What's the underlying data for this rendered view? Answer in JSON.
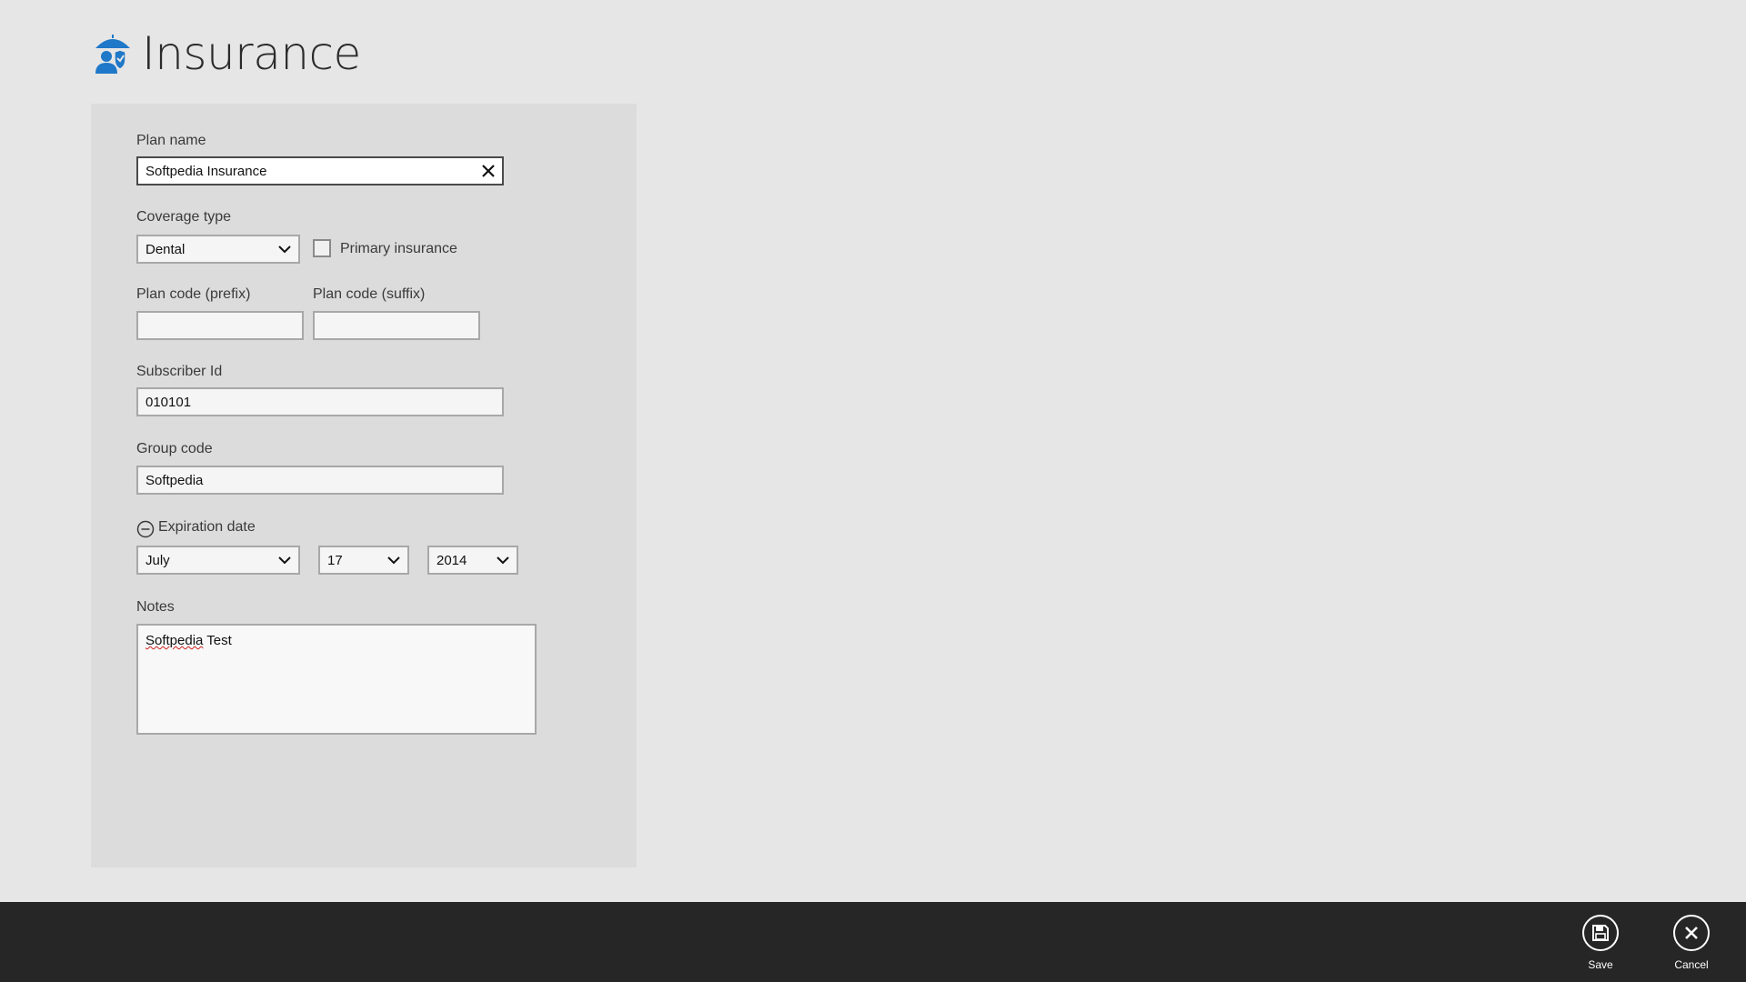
{
  "header": {
    "title": "Insurance",
    "icon": "umbrella-person-icon",
    "accent": "#1f78c8"
  },
  "form": {
    "plan_name": {
      "label": "Plan name",
      "value": "Softpedia Insurance"
    },
    "coverage_type": {
      "label": "Coverage type",
      "value": "Dental"
    },
    "primary_insurance": {
      "label": "Primary insurance",
      "checked": false
    },
    "plan_code_prefix": {
      "label": "Plan code (prefix)",
      "value": ""
    },
    "plan_code_suffix": {
      "label": "Plan code (suffix)",
      "value": ""
    },
    "subscriber_id": {
      "label": "Subscriber Id",
      "value": "010101"
    },
    "group_code": {
      "label": "Group code",
      "value": "Softpedia"
    },
    "expiration_date": {
      "label": "Expiration date",
      "month": "July",
      "day": "17",
      "year": "2014"
    },
    "notes": {
      "label": "Notes",
      "value_word1": "Softpedia",
      "value_word2": " Test"
    }
  },
  "appbar": {
    "save_label": "Save",
    "cancel_label": "Cancel",
    "background": "#262626"
  }
}
